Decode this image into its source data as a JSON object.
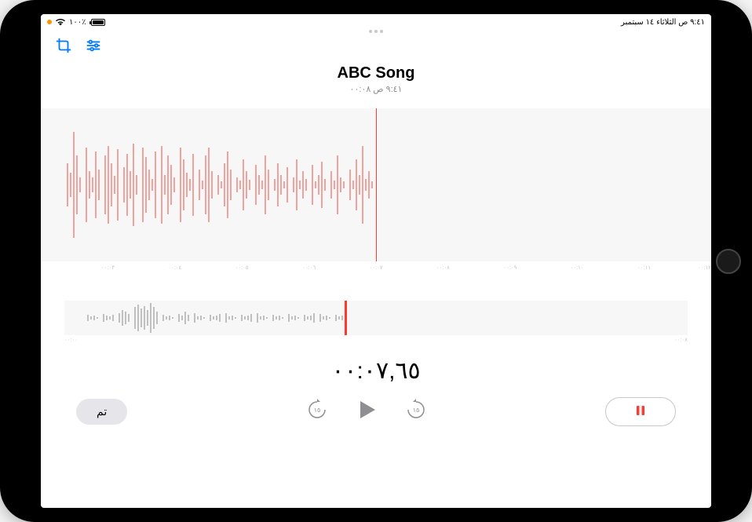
{
  "statusBar": {
    "date": "٩:٤١ ص الثلاثاء ١٤ سبتمبر",
    "battery": "١٠٠٪"
  },
  "header": {
    "title": "ABC Song",
    "subtitle": "٩:٤١ ص  ٠٠:٠٨"
  },
  "timeRuler": {
    "ticks": [
      "٠٠:٠٣",
      "٠٠:٠٤",
      "٠٠:٠٥",
      "٠٠:٠٦",
      "٠٠:٠٧",
      "٠٠:٠٨",
      "٠٠:٠٩",
      "٠٠:١٠",
      "٠٠:١١",
      "٠٠:١٢"
    ]
  },
  "overview": {
    "startLabel": "٠٠:٠٠",
    "endLabel": "٠٠:٠٨"
  },
  "timeDisplay": "٠٠:٠٧,٦٥",
  "controls": {
    "done": "تم"
  },
  "colors": {
    "accent": "#ff3b30",
    "blue": "#007aff",
    "gray": "#8e8e93"
  }
}
